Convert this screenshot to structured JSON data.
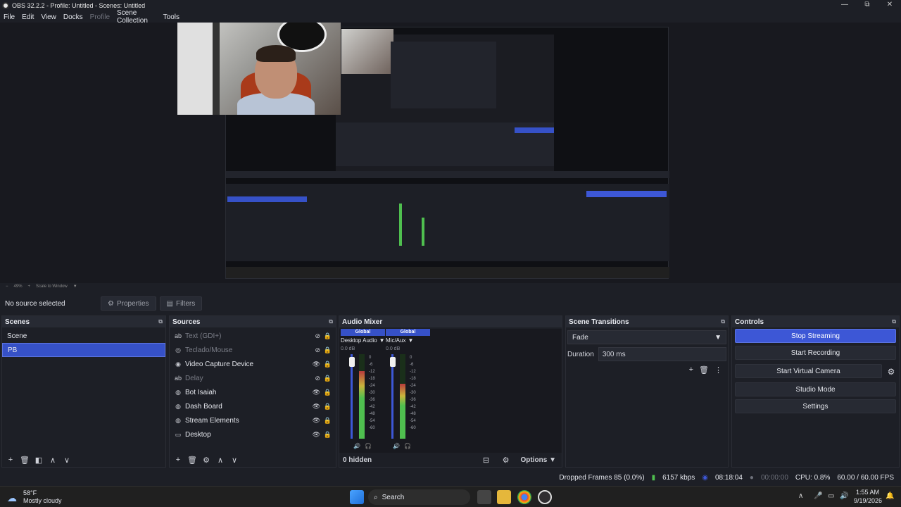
{
  "window": {
    "title": "OBS 32.2.2 - Profile: Untitled - Scenes: Untitled",
    "minimize": "—",
    "maximize": "⧉",
    "close": "✕"
  },
  "menu": [
    "File",
    "Edit",
    "View",
    "Docks",
    "Profile",
    "Scene Collection",
    "Tools"
  ],
  "preview": {
    "zoom": "49%",
    "scale_mode": "Scale to Window"
  },
  "context": {
    "no_source": "No source selected",
    "properties": "Properties",
    "filters": "Filters"
  },
  "scenes": {
    "title": "Scenes",
    "items": [
      {
        "label": "Scene",
        "active": false
      },
      {
        "label": "PB",
        "active": true
      }
    ]
  },
  "sources": {
    "title": "Sources",
    "items": [
      {
        "label": "Text (GDI+)",
        "icon": "text-icon",
        "visible": false
      },
      {
        "label": "Teclado/Mouse",
        "icon": "capture-icon",
        "visible": false
      },
      {
        "label": "Video Capture Device",
        "icon": "camera-icon",
        "visible": true
      },
      {
        "label": "Delay",
        "icon": "text-icon",
        "visible": false
      },
      {
        "label": "Bot Isaiah",
        "icon": "browser-icon",
        "visible": true
      },
      {
        "label": "Dash Board",
        "icon": "browser-icon",
        "visible": true
      },
      {
        "label": "Stream Elements",
        "icon": "browser-icon",
        "visible": true
      },
      {
        "label": "Desktop",
        "icon": "display-icon",
        "visible": true
      }
    ]
  },
  "audio_mixer": {
    "title": "Audio Mixer",
    "hidden_label": "0 hidden",
    "options_label": "Options",
    "scale": [
      "0",
      "-6",
      "-12",
      "-18",
      "-24",
      "-30",
      "-36",
      "-42",
      "-48",
      "-54",
      "-60"
    ],
    "channels": [
      {
        "badge": "Global",
        "name": "Desktop Audio",
        "db": "0.0 dB",
        "level": 0.8
      },
      {
        "badge": "Global",
        "name": "Mic/Aux",
        "db": "0.0 dB",
        "level": 0.65
      }
    ]
  },
  "transitions": {
    "title": "Scene Transitions",
    "selected": "Fade",
    "duration_label": "Duration",
    "duration_value": "300 ms"
  },
  "controls": {
    "title": "Controls",
    "stop_streaming": "Stop Streaming",
    "start_recording": "Start Recording",
    "start_virtual_camera": "Start Virtual Camera",
    "studio_mode": "Studio Mode",
    "settings": "Settings"
  },
  "status": {
    "dropped_frames": "Dropped Frames 85 (0.0%)",
    "bitrate": "6157 kbps",
    "stream_time": "08:18:04",
    "record_time": "00:00:00",
    "cpu": "CPU: 0.8%",
    "fps": "60.00 / 60.00 FPS"
  },
  "taskbar": {
    "weather_temp": "58°F",
    "weather_desc": "Mostly cloudy",
    "search": "Search",
    "time": "1:55 AM",
    "date": "9/19/2026"
  },
  "colors": {
    "accent": "#3d57d6",
    "panel": "#1d1f26",
    "panel_header": "#272a33"
  }
}
